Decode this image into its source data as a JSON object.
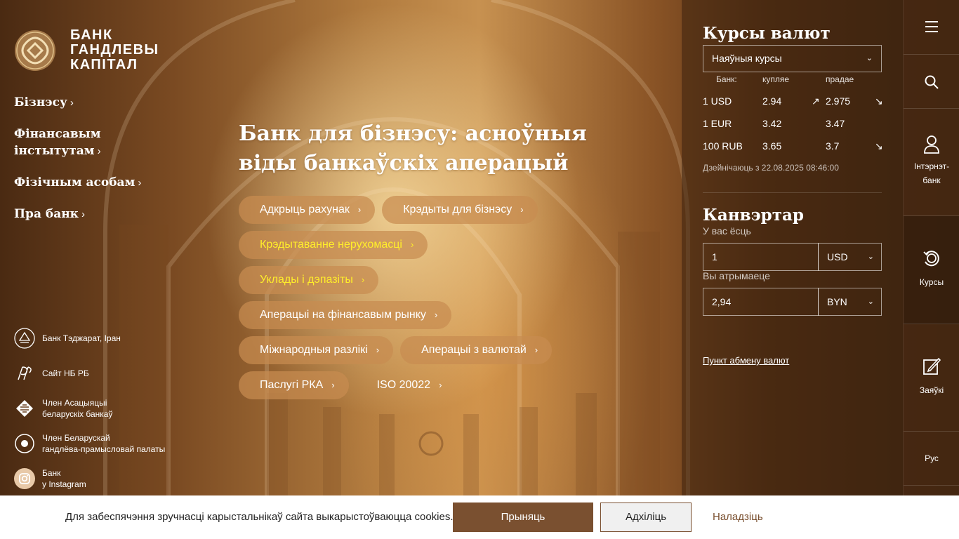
{
  "logo": {
    "line1": "БАНК",
    "line2": "ГАНДЛЕВЫ",
    "line3": "КАПІТАЛ"
  },
  "left_nav": [
    {
      "label": "Бізнэсу",
      "chevron": "›"
    },
    {
      "label": "Фінансавым",
      "label2": "інстытутам",
      "chevron": "›"
    },
    {
      "label": "Фізічным асобам",
      "chevron": "›"
    },
    {
      "label": "Пра банк",
      "chevron": "›"
    }
  ],
  "partners": [
    {
      "icon": "tejarat-bank-icon",
      "line1": "Банк Тэджарат, Іран",
      "line2": ""
    },
    {
      "icon": "nbrb-icon",
      "line1": "Сайт НБ РБ",
      "line2": ""
    },
    {
      "icon": "banks-association-icon",
      "line1": "Член Асацыяцыі",
      "line2": "беларускіх банкаў"
    },
    {
      "icon": "chamber-of-commerce-icon",
      "line1": "Член Беларускай",
      "line2": "гандлёва-прамысловай палаты"
    },
    {
      "icon": "instagram-icon",
      "line1": "Банк",
      "line2": "у Instagram"
    }
  ],
  "main": {
    "headline_line1": "Банк для бізнэсу: асноўныя",
    "headline_line2": "віды банкаўскіх аперацый",
    "pills": [
      {
        "label": "Адкрыць рахунак",
        "chevron": "›",
        "highlight": false
      },
      {
        "label": "Крэдыты для бізнэсу",
        "chevron": "›",
        "highlight": false
      },
      {
        "label": "Крэдытаванне нерухомасці",
        "chevron": "›",
        "highlight": true
      },
      {
        "label": "Уклады і дэпазіты",
        "chevron": "›",
        "highlight": true
      },
      {
        "label": "Аперацыі на фінансавым рынку",
        "chevron": "›",
        "highlight": false
      },
      {
        "label": "Міжнародныя разлікі",
        "chevron": "›",
        "highlight": false
      },
      {
        "label": "Аперацыі з валютай",
        "chevron": "›",
        "highlight": false
      },
      {
        "label": "Паслугі РКА",
        "chevron": "›",
        "highlight": false
      },
      {
        "label": "ISO 20022",
        "chevron": "›",
        "highlight": false
      }
    ]
  },
  "rates": {
    "title": "Курсы валют",
    "type_select": "Наяўныя курсы",
    "col_bank": "Банк:",
    "col_buy": "купляе",
    "col_sell": "прадае",
    "rows": [
      {
        "currency": "1 USD",
        "buy": "2.94",
        "buy_arrow": "↗",
        "sell": "2.975",
        "sell_arrow": "↘"
      },
      {
        "currency": "1 EUR",
        "buy": "3.42",
        "buy_arrow": "",
        "sell": "3.47",
        "sell_arrow": ""
      },
      {
        "currency": "100 RUB",
        "buy": "3.65",
        "buy_arrow": "",
        "sell": "3.7",
        "sell_arrow": "↘"
      }
    ],
    "updated": "Дзейнічаюць з 22.08.2025 08:46:00"
  },
  "converter": {
    "title": "Канвэртар",
    "have_label": "У вас ёсць",
    "have_value": "1",
    "have_currency": "USD",
    "get_label": "Вы атрымаеце",
    "get_value": "2,94",
    "get_currency": "BYN",
    "exchange_link": "Пункт абмену валют"
  },
  "right_bar": {
    "menu_icon": "hamburger-menu-icon",
    "search_icon": "search-icon",
    "internet_bank_line1": "Інтэрнэт-",
    "internet_bank_line2": "банк",
    "rates_label": "Курсы",
    "requests_label": "Заяўкі",
    "language_label": "Рус"
  },
  "cookies": {
    "text": "Для забеспячэння зручнасці карыстальнікаў сайта выкарыстоўваюцца cookies.",
    "accept": "Прыняць",
    "decline": "Адхіліць",
    "settings": "Наладзіць"
  },
  "colors": {
    "accent_brown": "#7a5030",
    "highlight_yellow": "#ffee2a",
    "pill_bg": "#c88c50"
  }
}
